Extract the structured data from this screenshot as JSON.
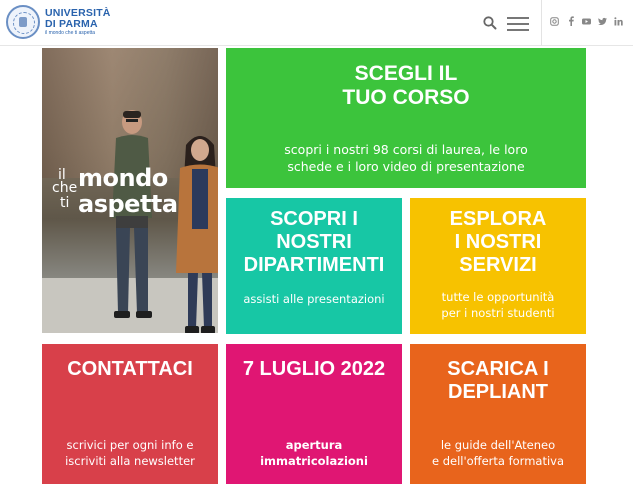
{
  "header": {
    "logo_name_line1": "UNIVERSITÀ",
    "logo_name_line2": "DI PARMA",
    "logo_tagline": "il mondo che ti aspetta",
    "social_icons": [
      "instagram-icon",
      "facebook-icon",
      "youtube-icon",
      "twitter-icon",
      "linkedin-icon"
    ]
  },
  "hero": {
    "word_il": "il",
    "word_che": "che",
    "word_ti": "ti",
    "word_mondo": "mondo",
    "word_aspetta": "aspetta"
  },
  "tiles": [
    {
      "id": "corso",
      "title_lines": [
        "SCEGLI IL",
        "TUO CORSO"
      ],
      "sub_lines": [
        "scopri i nostri 98 corsi di laurea, le loro",
        "schede e i loro video di presentazione"
      ],
      "color": "#3cc43c"
    },
    {
      "id": "dipartimenti",
      "title_lines": [
        "SCOPRI I",
        "NOSTRI",
        "DIPARTIMENTI"
      ],
      "sub_lines": [
        "assisti alle presentazioni"
      ],
      "color": "#17c7a5"
    },
    {
      "id": "servizi",
      "title_lines": [
        "ESPLORA",
        "I NOSTRI",
        "SERVIZI"
      ],
      "sub_lines": [
        "tutte le opportunità",
        "per i nostri studenti"
      ],
      "color": "#f7c200"
    },
    {
      "id": "contattaci",
      "title_lines": [
        "CONTATTACI"
      ],
      "sub_lines": [
        "scrivici per ogni info e",
        "iscriviti alla newsletter"
      ],
      "color": "#d8404a"
    },
    {
      "id": "luglio",
      "title_lines": [
        "7 LUGLIO 2022"
      ],
      "sub_lines": [
        "apertura",
        "immatricolazioni"
      ],
      "color": "#e01673"
    },
    {
      "id": "depliant",
      "title_lines": [
        "SCARICA I",
        "DEPLIANT"
      ],
      "sub_lines": [
        "le guide dell'Ateneo",
        "e dell'offerta formativa"
      ],
      "color": "#e8641c"
    }
  ]
}
